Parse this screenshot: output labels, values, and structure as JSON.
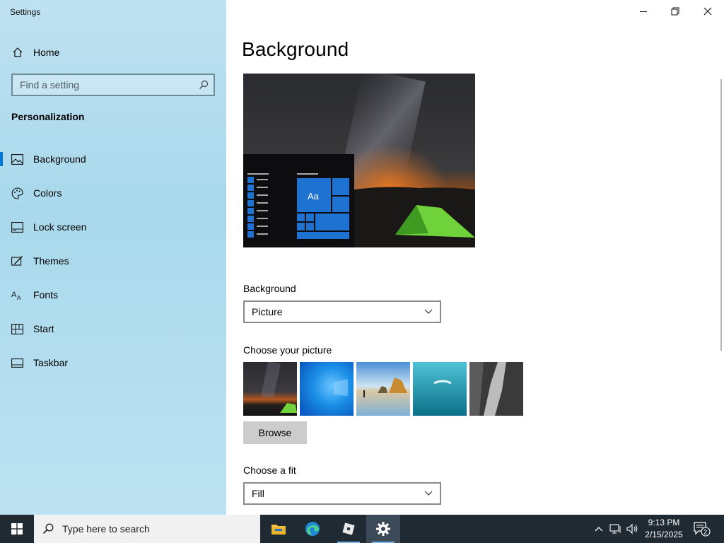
{
  "window": {
    "title": "Settings",
    "controls": {
      "minimize": "minimize",
      "restore": "restore",
      "close": "close"
    }
  },
  "sidebar": {
    "home_label": "Home",
    "search_placeholder": "Find a setting",
    "section_title": "Personalization",
    "selected_index": 0,
    "items": [
      {
        "label": "Background",
        "icon": "picture-icon"
      },
      {
        "label": "Colors",
        "icon": "palette-icon"
      },
      {
        "label": "Lock screen",
        "icon": "lock-screen-icon"
      },
      {
        "label": "Themes",
        "icon": "themes-icon"
      },
      {
        "label": "Fonts",
        "icon": "fonts-icon"
      },
      {
        "label": "Start",
        "icon": "start-icon"
      },
      {
        "label": "Taskbar",
        "icon": "taskbar-icon"
      }
    ]
  },
  "main": {
    "title": "Background",
    "preview": {
      "tile_label": "Aa"
    },
    "background_label": "Background",
    "background_value": "Picture",
    "choose_picture_label": "Choose your picture",
    "pictures": [
      "milky-way-tent",
      "windows-blue",
      "beach-rocks",
      "underwater-swimmer",
      "rock-cliff"
    ],
    "browse_label": "Browse",
    "fit_label": "Choose a fit",
    "fit_value": "Fill"
  },
  "taskbar": {
    "search_placeholder": "Type here to search",
    "apps": [
      "file-explorer",
      "edge",
      "roblox",
      "settings"
    ],
    "active_app": "settings",
    "time": "9:13 PM",
    "date": "2/15/2025",
    "notification_count": "2"
  },
  "colors": {
    "accent": "#0078d4",
    "sidebar_bg": "#a9d8ec",
    "taskbar_bg": "#1f2a33"
  }
}
